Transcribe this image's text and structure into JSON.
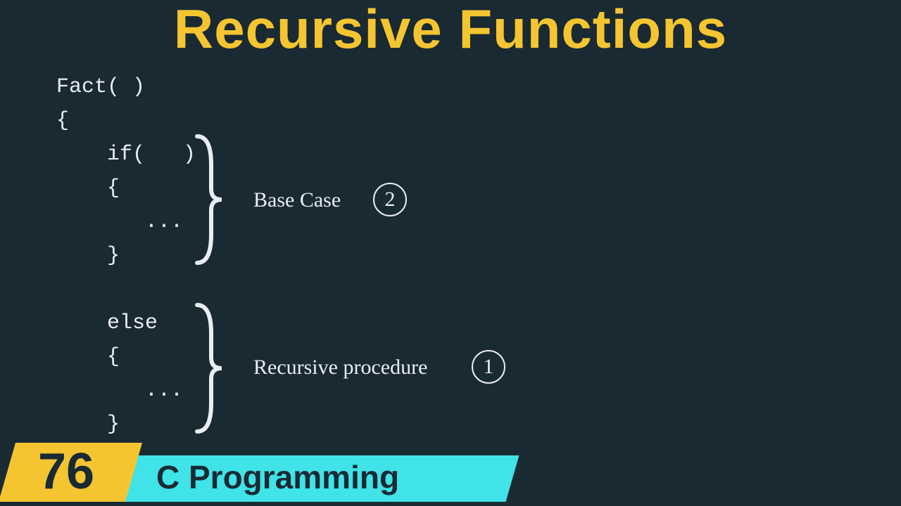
{
  "title": "Recursive Functions",
  "code": {
    "line1": "Fact( )",
    "line2": "{",
    "line3": "    if(   )",
    "line4": "    {",
    "line5": "       ...",
    "line6": "    }",
    "line7": "",
    "line8": "    else",
    "line9": "    {",
    "line10": "       ...",
    "line11": "    }"
  },
  "annotations": {
    "base_case": {
      "label": "Base Case",
      "step": "2"
    },
    "recursive": {
      "label": "Recursive procedure",
      "step": "1"
    }
  },
  "footer": {
    "lesson_number": "76",
    "course_name": "C Programming"
  }
}
